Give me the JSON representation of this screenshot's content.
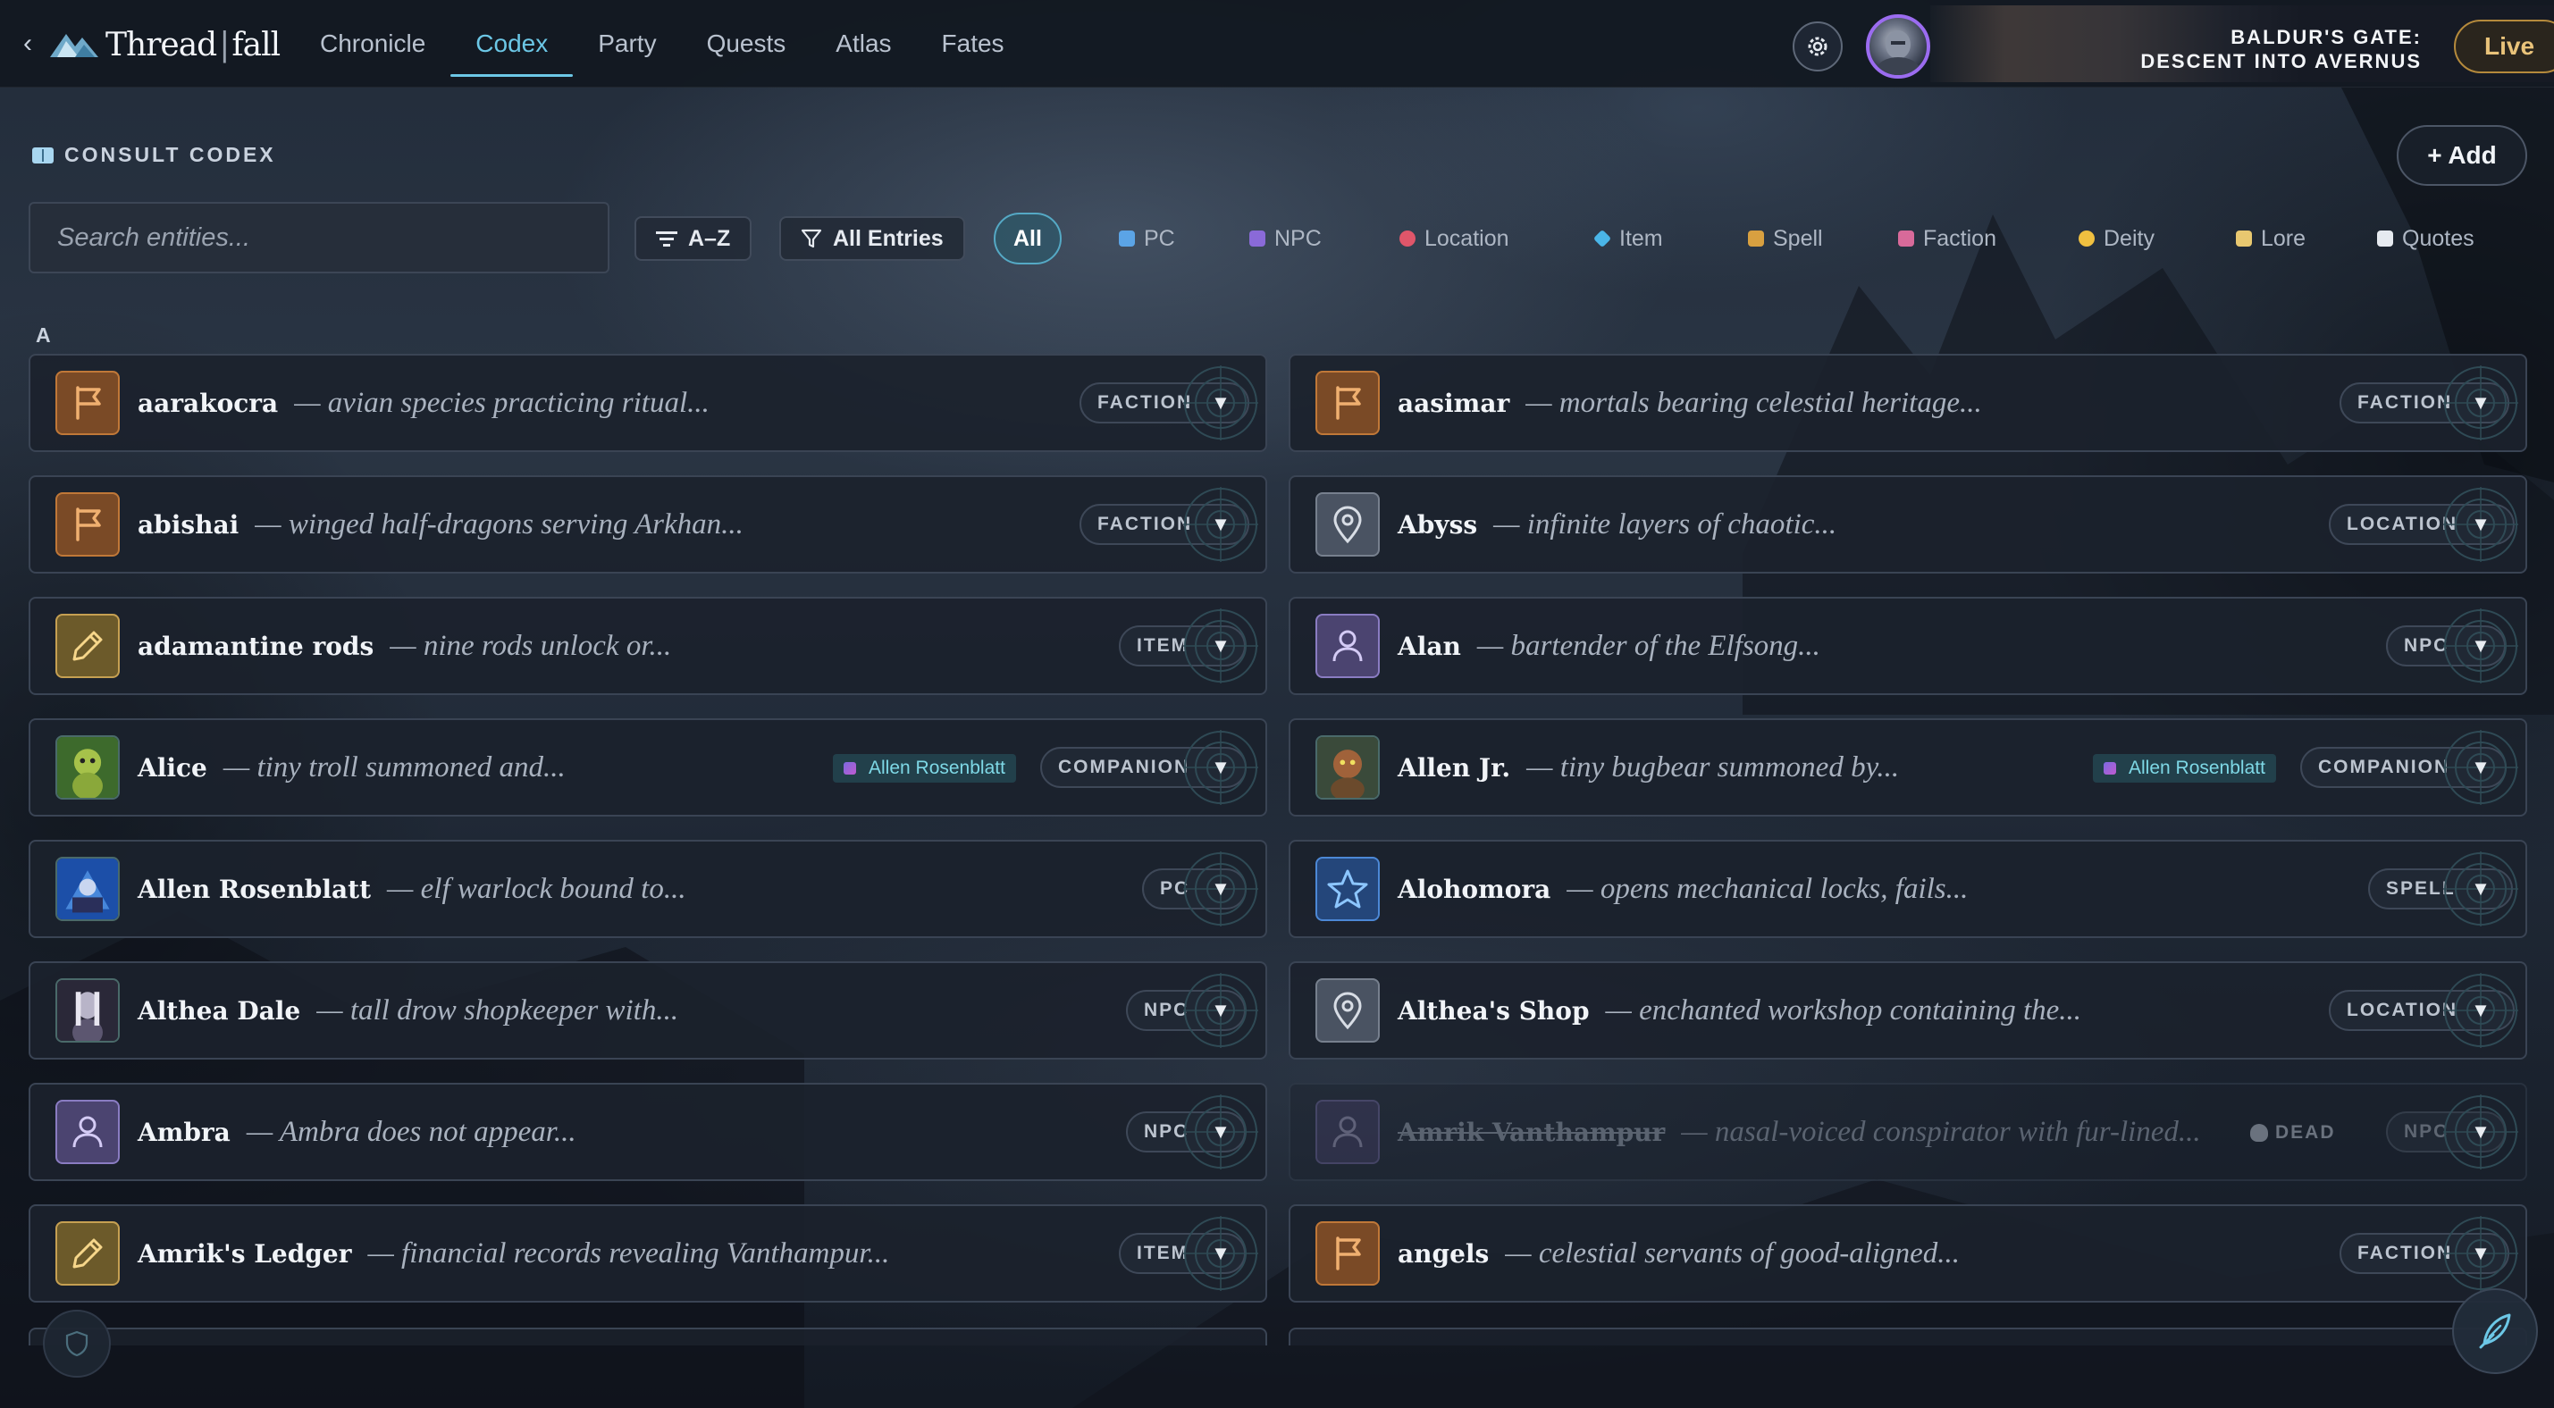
{
  "app": {
    "back_glyph": "‹",
    "logo_part1": "Thread",
    "logo_sep": "|",
    "logo_part2": "fall"
  },
  "nav": {
    "tabs": [
      {
        "label": "Chronicle",
        "active": false
      },
      {
        "label": "Codex",
        "active": true
      },
      {
        "label": "Party",
        "active": false
      },
      {
        "label": "Quests",
        "active": false
      },
      {
        "label": "Atlas",
        "active": false
      },
      {
        "label": "Fates",
        "active": false
      }
    ]
  },
  "campaign": {
    "title_line1": "BALDUR'S GATE:",
    "title_line2": "DESCENT INTO AVERNUS",
    "live_label": "Live"
  },
  "codex": {
    "header_label": "CONSULT CODEX",
    "add_label": "+ Add",
    "search_placeholder": "Search entities...",
    "sort_label": "A–Z",
    "filter_label": "All Entries",
    "section_letter": "A"
  },
  "chips": [
    {
      "label": "All",
      "active": true,
      "icon": "none"
    },
    {
      "label": "PC",
      "icon": "pc-icon",
      "color": "#5ba4e6"
    },
    {
      "label": "NPC",
      "icon": "npc-icon",
      "color": "#8a6ad8"
    },
    {
      "label": "Location",
      "icon": "pin-icon",
      "color": "#e0566a"
    },
    {
      "label": "Item",
      "icon": "gem-icon",
      "color": "#4ab6e8"
    },
    {
      "label": "Spell",
      "icon": "wand-icon",
      "color": "#d8a040"
    },
    {
      "label": "Faction",
      "icon": "castle-icon",
      "color": "#d86a9a"
    },
    {
      "label": "Deity",
      "icon": "sun-icon",
      "color": "#f0c040"
    },
    {
      "label": "Lore",
      "icon": "scroll-icon",
      "color": "#e8c870"
    },
    {
      "label": "Quotes",
      "icon": "speech-icon",
      "color": "#e6eaf0"
    }
  ],
  "entities": [
    {
      "name": "aarakocra",
      "desc": "— avian species practicing ritual...",
      "type": "FACTION",
      "icon": "flag-icon"
    },
    {
      "name": "aasimar",
      "desc": "— mortals bearing celestial heritage...",
      "type": "FACTION",
      "icon": "flag-icon"
    },
    {
      "name": "abishai",
      "desc": "— winged half-dragons serving Arkhan...",
      "type": "FACTION",
      "icon": "flag-icon"
    },
    {
      "name": "Abyss",
      "desc": "— infinite layers of chaotic...",
      "type": "LOCATION",
      "icon": "pin-icon"
    },
    {
      "name": "adamantine rods",
      "desc": "— nine rods unlock or...",
      "type": "ITEM",
      "icon": "pencil-icon"
    },
    {
      "name": "Alan",
      "desc": "— bartender of the Elfsong...",
      "type": "NPC",
      "icon": "person-icon"
    },
    {
      "name": "Alice",
      "desc": "— tiny troll summoned and...",
      "type": "COMPANION",
      "icon": "troll-portrait-icon",
      "owner": "Allen Rosenblatt"
    },
    {
      "name": "Allen Jr.",
      "desc": "— tiny bugbear summoned by...",
      "type": "COMPANION",
      "icon": "bugbear-portrait-icon",
      "owner": "Allen Rosenblatt"
    },
    {
      "name": "Allen Rosenblatt",
      "desc": "— elf warlock bound to...",
      "type": "PC",
      "icon": "warlock-portrait-icon"
    },
    {
      "name": "Alohomora",
      "desc": "— opens mechanical locks, fails...",
      "type": "SPELL",
      "icon": "star-icon"
    },
    {
      "name": "Althea Dale",
      "desc": "— tall drow shopkeeper with...",
      "type": "NPC",
      "icon": "drow-portrait-icon"
    },
    {
      "name": "Althea's Shop",
      "desc": "— enchanted workshop containing the...",
      "type": "LOCATION",
      "icon": "pin-icon"
    },
    {
      "name": "Ambra",
      "desc": "— Ambra does not appear...",
      "type": "NPC",
      "icon": "person-icon"
    },
    {
      "name": "Amrik Vanthampur",
      "desc": "— nasal-voiced conspirator with fur-lined...",
      "type": "NPC",
      "icon": "person-icon",
      "dead_label": "DEAD"
    },
    {
      "name": "Amrik's Ledger",
      "desc": "— financial records revealing Vanthampur...",
      "type": "ITEM",
      "icon": "pencil-icon"
    },
    {
      "name": "angels",
      "desc": "— celestial servants of good-aligned...",
      "type": "FACTION",
      "icon": "flag-icon"
    }
  ]
}
